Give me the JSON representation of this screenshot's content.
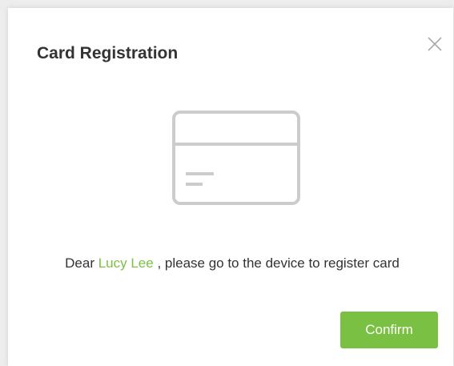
{
  "dialog": {
    "title": "Card Registration",
    "close_icon": "close-icon",
    "illustration_icon": "card-icon",
    "message": {
      "prefix": "Dear ",
      "user_name": "Lucy Lee",
      "suffix": " , please go to the device to register card"
    },
    "confirm_label": "Confirm"
  },
  "colors": {
    "accent": "#7ac143",
    "title_text": "#333333",
    "icon_gray": "#cccccc"
  }
}
